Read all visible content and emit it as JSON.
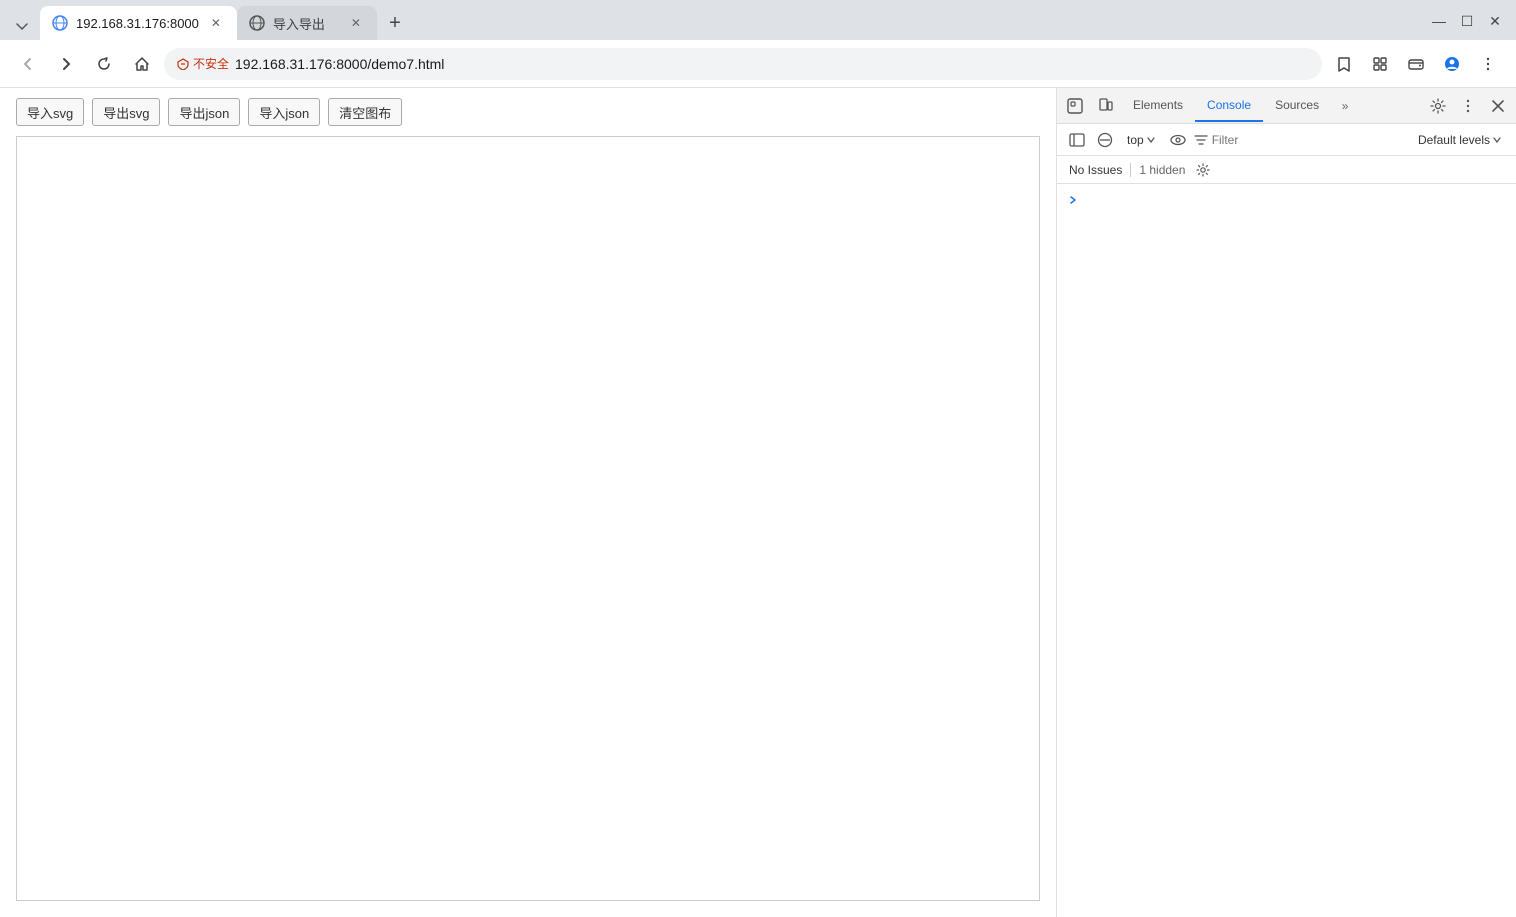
{
  "browser": {
    "tabs": [
      {
        "id": "tab1",
        "title": "192.168.31.176:8000",
        "favicon": "globe",
        "active": true,
        "url": "192.168.31.176:8000"
      },
      {
        "id": "tab2",
        "title": "导入导出",
        "favicon": "globe",
        "active": false,
        "url": "导入导出"
      }
    ],
    "address": "192.168.31.176:8000/demo7.html",
    "security_label": "不安全"
  },
  "page": {
    "buttons": [
      {
        "id": "import-svg",
        "label": "导入svg"
      },
      {
        "id": "export-svg",
        "label": "导出svg"
      },
      {
        "id": "export-json",
        "label": "导出json"
      },
      {
        "id": "import-json",
        "label": "导入json"
      },
      {
        "id": "clear-canvas",
        "label": "清空图布"
      }
    ]
  },
  "devtools": {
    "tabs": [
      {
        "id": "elements",
        "label": "Elements",
        "active": false
      },
      {
        "id": "console",
        "label": "Console",
        "active": true
      },
      {
        "id": "sources",
        "label": "Sources",
        "active": false
      }
    ],
    "console": {
      "top_selector": "top",
      "filter_placeholder": "Filter",
      "default_levels": "Default levels",
      "no_issues": "No Issues",
      "hidden_count": "1 hidden"
    }
  }
}
